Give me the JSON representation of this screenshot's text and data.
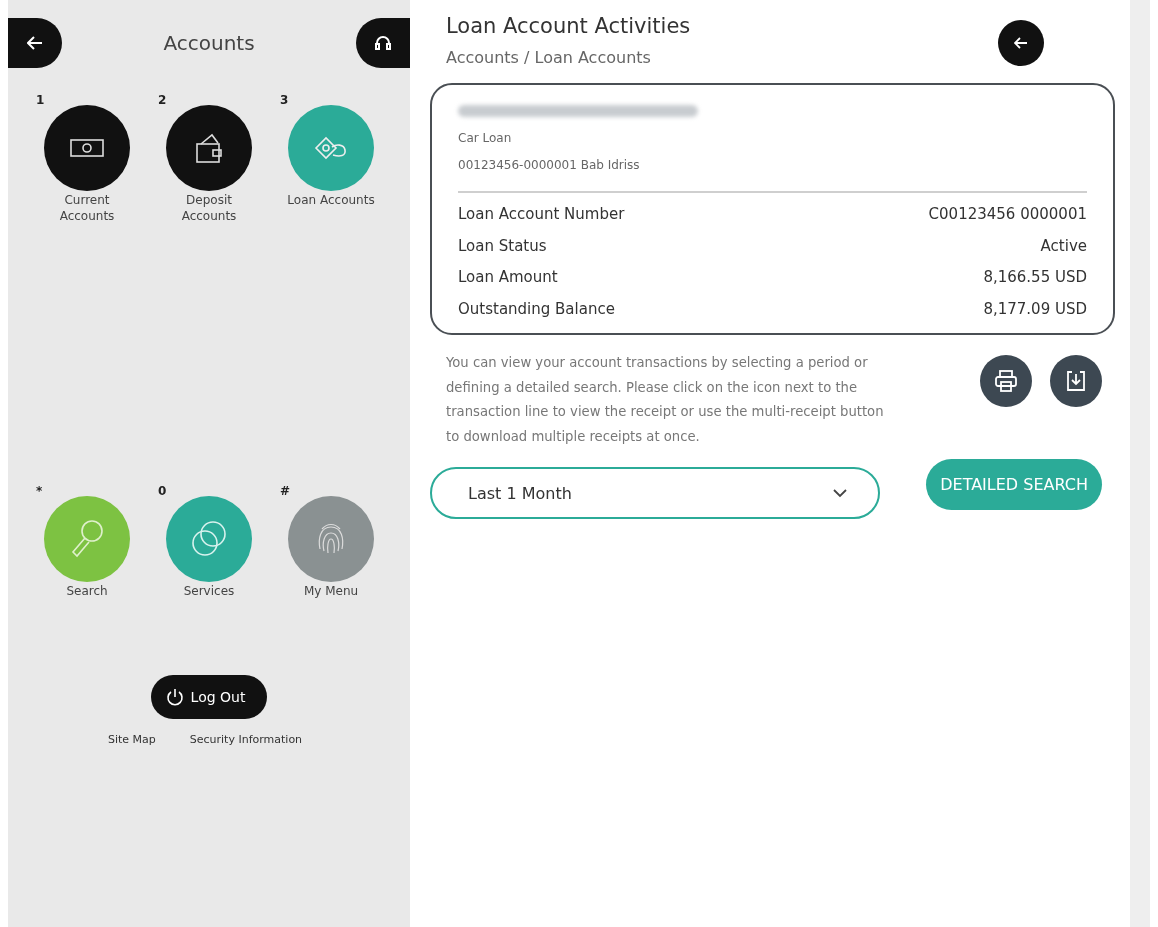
{
  "sidebar": {
    "title": "Accounts",
    "tiles": [
      {
        "key": "1",
        "label": "Current Accounts",
        "color": "#111111"
      },
      {
        "key": "2",
        "label": "Deposit Accounts",
        "color": "#111111"
      },
      {
        "key": "3",
        "label": "Loan Accounts",
        "color": "#2bab98"
      }
    ],
    "shortcuts": [
      {
        "key": "*",
        "label": "Search",
        "color": "#7dc242"
      },
      {
        "key": "0",
        "label": "Services",
        "color": "#2bab98"
      },
      {
        "key": "#",
        "label": "My Menu",
        "color": "#8a9192"
      }
    ],
    "logout": "Log Out",
    "links": [
      "Site Map",
      "Security Information"
    ]
  },
  "main": {
    "title": "Loan Account Activities",
    "breadcrumb": "Accounts / Loan Accounts",
    "card": {
      "product": "Car Loan",
      "account_line": "00123456-0000001 Bab Idriss",
      "rows": [
        {
          "label": "Loan Account Number",
          "value": "C00123456 0000001"
        },
        {
          "label": "Loan Status",
          "value": "Active"
        },
        {
          "label": "Loan Amount",
          "value": "8,166.55 USD"
        },
        {
          "label": "Outstanding Balance",
          "value": "8,177.09 USD"
        }
      ]
    },
    "info": "You can view your account transactions by selecting a period or defining a detailed search. Please click on the icon next to the transaction line to view the receipt or use the multi-receipt button to download multiple receipts at once.",
    "period": {
      "value": "Last 1 Month"
    },
    "search_button": "DETAILED SEARCH"
  }
}
